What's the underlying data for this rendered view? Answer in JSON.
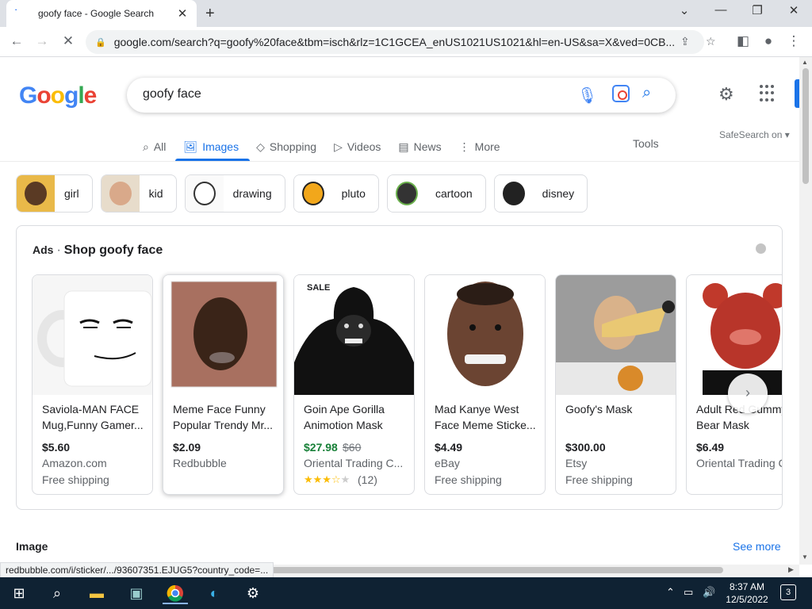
{
  "browser": {
    "tab_title": "goofy face - Google Search",
    "url": "google.com/search?q=goofy%20face&tbm=isch&rlz=1C1GCEA_enUS1021US1021&hl=en-US&sa=X&ved=0CB..."
  },
  "search": {
    "query": "goofy face",
    "tabs": [
      {
        "label": "All",
        "icon": "search-icon"
      },
      {
        "label": "Images",
        "icon": "image-icon",
        "active": true
      },
      {
        "label": "Shopping",
        "icon": "tag-icon"
      },
      {
        "label": "Videos",
        "icon": "play-icon"
      },
      {
        "label": "News",
        "icon": "news-icon"
      },
      {
        "label": "More",
        "icon": "more-dots-icon"
      }
    ],
    "tools_label": "Tools",
    "safesearch_label": "SafeSearch on"
  },
  "chips": [
    "girl",
    "kid",
    "drawing",
    "pluto",
    "cartoon",
    "disney"
  ],
  "ads": {
    "label": "Ads",
    "heading": "Shop goofy face",
    "products": [
      {
        "title": "Saviola-MAN FACE Mug,Funny Gamer...",
        "price": "$5.60",
        "seller": "Amazon.com",
        "shipping": "Free shipping"
      },
      {
        "title": "Meme Face Funny Popular Trendy Mr...",
        "price": "$2.09",
        "seller": "Redbubble"
      },
      {
        "title": "Goin Ape Gorilla Animotion Mask",
        "price": "$27.98",
        "old_price": "$60",
        "seller": "Oriental Trading C...",
        "badge": "SALE",
        "rating": 3.5,
        "reviews": "(12)"
      },
      {
        "title": "Mad Kanye West Face Meme Sticke...",
        "price": "$4.49",
        "seller": "eBay",
        "shipping": "Free shipping"
      },
      {
        "title": "Goofy's Mask",
        "price": "$300.00",
        "seller": "Etsy",
        "shipping": "Free shipping"
      },
      {
        "title": "Adult Red Gummy Bear Mask",
        "price": "$6.49",
        "seller": "Oriental Trading C"
      }
    ]
  },
  "image_section": {
    "heading": "Image",
    "see_more": "See more"
  },
  "status_url": "redbubble.com/i/sticker/.../93607351.EJUG5?country_code=...",
  "taskbar": {
    "time": "8:37 AM",
    "date": "12/5/2022",
    "notifications": "3"
  }
}
